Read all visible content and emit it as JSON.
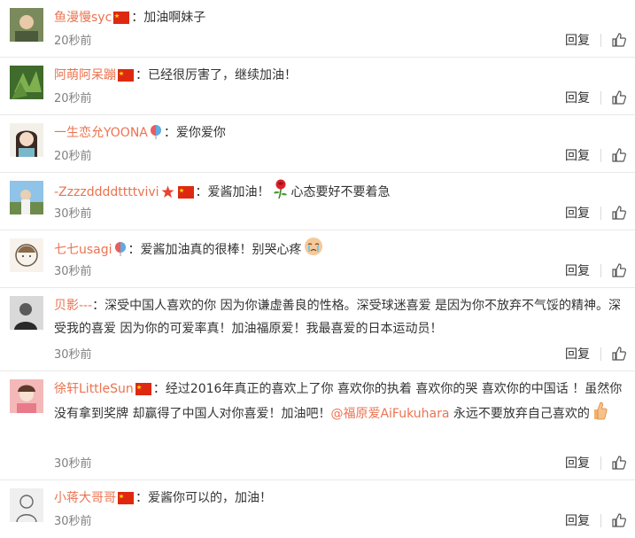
{
  "colors": {
    "name": "#eb7350",
    "time": "#808080",
    "text": "#333333",
    "divider": "#e8e8e8"
  },
  "labels": {
    "reply": "回复"
  },
  "comments": [
    {
      "name": "鱼漫慢syc",
      "colon": "：",
      "text": "加油啊妹子",
      "time": "20秒前",
      "icons": [
        "china-flag-icon"
      ]
    },
    {
      "name": "阿萌阿呆蹦",
      "colon": "：",
      "text": "已经很厉害了，继续加油！",
      "time": "20秒前",
      "icons": [
        "china-flag-icon"
      ]
    },
    {
      "name": "一生恋允YOONA",
      "colon": "：",
      "text": "爱你爱你",
      "time": "20秒前",
      "icons": [
        "rainbow-balloon-icon"
      ]
    },
    {
      "name": "-Zzzzddddttttvivi",
      "colon": "：",
      "text": "爱酱加油！",
      "text2": "心态要好不要着急",
      "time": "30秒前",
      "icons": [
        "red-star-icon",
        "china-flag-icon",
        "rose-icon"
      ]
    },
    {
      "name": "七七usagi",
      "colon": "：",
      "text": "爱酱加油真的很棒！别哭心疼",
      "time": "30秒前",
      "icons": [
        "rainbow-balloon-icon",
        "crying-face-icon"
      ]
    },
    {
      "name": "贝影---",
      "colon": "：",
      "text": "深受中国人喜欢的你 因为你谦虚善良的性格。深受球迷喜爱 是因为你不放弃不气馁的精神。深受我的喜爱 因为你的可爱率真！加油福原爱！我最喜爱的日本运动员！",
      "time": "30秒前",
      "icons": []
    },
    {
      "name": "徐轩LittleSun",
      "colon": "：",
      "text": "经过2016年真正的喜欢上了你 喜欢你的执着 喜欢你的哭 喜欢你的中国话 ！虽然你没有拿到奖牌 却赢得了中国人对你喜爱！加油吧！",
      "mention": "@福原爱AiFukuhara",
      "text2": " 永远不要放弃自己喜欢的",
      "time": "30秒前",
      "icons": [
        "china-flag-icon",
        "thumbs-up-emoji-icon"
      ]
    },
    {
      "name": "小蒋大哥哥",
      "colon": "：",
      "text": "爱酱你可以的，加油！",
      "time": "30秒前",
      "icons": [
        "china-flag-icon"
      ]
    }
  ]
}
